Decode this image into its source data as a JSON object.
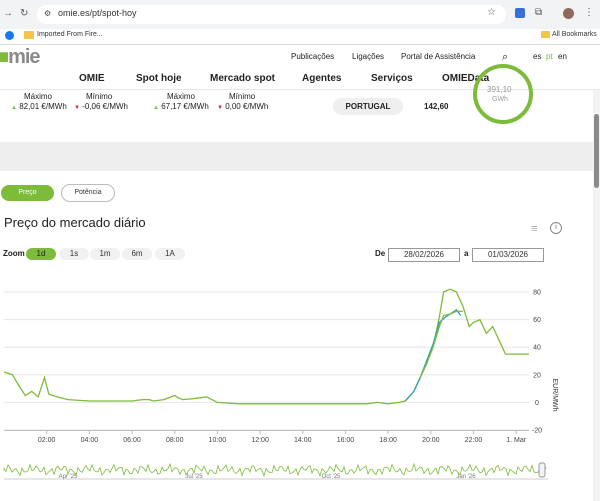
{
  "browser": {
    "url": "omie.es/pt/spot-hoy",
    "bookmark": "Imported From Fire...",
    "all_bookmarks": "All Bookmarks"
  },
  "header": {
    "logo": "mie",
    "top_nav": [
      "Publicações",
      "Ligações",
      "Portal de Assistência"
    ],
    "languages": [
      "es",
      "pt",
      "en"
    ],
    "active_language": "pt",
    "main_nav": [
      "OMIE",
      "Spot hoje",
      "Mercado spot",
      "Agentes",
      "Serviços",
      "OMIEData"
    ]
  },
  "market": {
    "left": {
      "max_label": "Máximo",
      "max_value": "82,01 €/MWh",
      "min_label": "Mínimo",
      "min_value": "-0,06 €/MWh"
    },
    "right": {
      "max_label": "Máximo",
      "max_value": "67,17 €/MWh",
      "min_label": "Mínimo",
      "min_value": "0,00 €/MWh"
    },
    "country": "PORTUGAL",
    "country_value": "142,60",
    "ring_value": "391,10",
    "ring_unit": "GWh"
  },
  "tabs": {
    "price": "Preço",
    "power": "Potência",
    "active": "Preço"
  },
  "chart_controls": {
    "title": "Preço do mercado diário",
    "zoom_label": "Zoom",
    "zoom_options": [
      "1d",
      "1s",
      "1m",
      "6m",
      "1A"
    ],
    "zoom_active": "1d",
    "from_label": "De",
    "from_date": "28/02/2026",
    "to_label": "a",
    "to_date": "01/03/2026"
  },
  "chart_data": {
    "type": "line",
    "title": "Preço do mercado diário",
    "ylabel": "EUR/MWh",
    "ylim": [
      -20,
      90
    ],
    "yticks": [
      -20,
      0,
      20,
      40,
      60,
      80
    ],
    "xtick_labels": [
      "02:00",
      "04:00",
      "06:00",
      "08:00",
      "10:00",
      "12:00",
      "14:00",
      "16:00",
      "18:00",
      "20:00",
      "22:00",
      "1. Mar"
    ],
    "xtick_hours": [
      2,
      4,
      6,
      8,
      10,
      12,
      14,
      16,
      18,
      20,
      22,
      24
    ],
    "xlim_hours": [
      0,
      24.6
    ],
    "colors": {
      "green": "#7dbb3a",
      "teal": "#2aa1b3"
    },
    "series": [
      {
        "color": "green",
        "x": [
          0,
          0.4,
          0.7,
          1.0,
          1.3,
          1.6,
          1.9,
          2.1,
          2.3,
          2.5,
          3.0,
          4.0,
          5.0,
          6.0,
          6.5,
          6.8,
          7.0,
          7.5,
          8.0,
          8.2,
          8.4,
          9.0,
          9.5,
          10.0,
          11.0,
          12.0,
          13.0,
          14.0,
          15.0,
          16.0,
          16.5,
          17.0,
          17.5,
          18.0,
          18.5,
          18.8,
          19.2,
          19.5,
          19.8,
          20.1,
          20.4,
          20.6,
          20.9,
          21.2,
          21.5,
          21.8,
          22.0,
          22.3,
          22.6,
          22.9,
          23.2,
          23.5,
          24.0,
          24.6
        ],
        "y": [
          22,
          20,
          12,
          5,
          8,
          4,
          18,
          6,
          5,
          4,
          2,
          1,
          1,
          1,
          2,
          2,
          1,
          2,
          5,
          3,
          2,
          3,
          4,
          0,
          -1,
          -1,
          -1,
          -1,
          -1,
          -1,
          -1,
          -1,
          0,
          -1,
          0,
          1,
          8,
          18,
          28,
          40,
          62,
          80,
          82,
          80,
          70,
          55,
          58,
          60,
          50,
          55,
          45,
          35,
          35,
          35
        ]
      },
      {
        "color": "teal",
        "x": [
          18.8,
          19.2,
          19.5,
          19.8,
          20.1,
          20.4,
          20.7,
          21.0,
          21.2,
          21.4
        ],
        "y": [
          1,
          8,
          18,
          30,
          42,
          58,
          62,
          65,
          67,
          63
        ]
      },
      {
        "color": "green",
        "x": [
          19.5,
          19.8,
          20.1,
          20.4,
          20.6,
          20.9,
          21.2,
          21.5
        ],
        "y": [
          18,
          28,
          40,
          55,
          63,
          64,
          66,
          66
        ]
      }
    ],
    "navigator_labels": [
      "Apr '25",
      "Jul '25",
      "Oct '25",
      "Jan '26"
    ]
  }
}
